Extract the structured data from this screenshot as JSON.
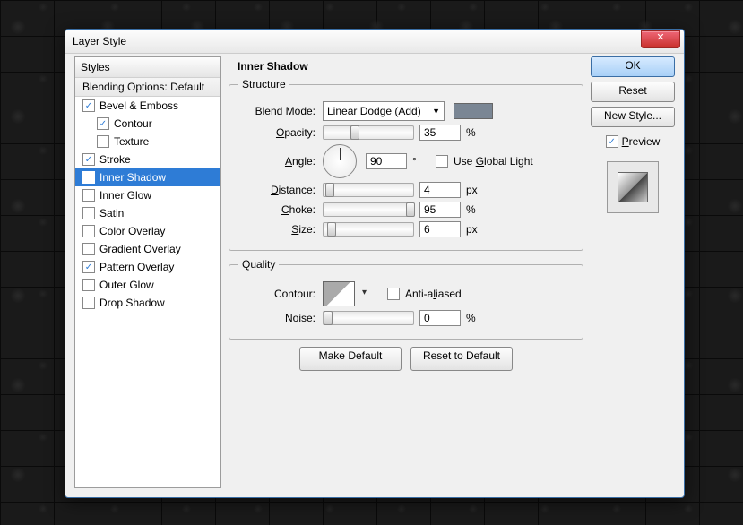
{
  "window_title": "Layer Style",
  "styles_header": "Styles",
  "blending": "Blending Options: Default",
  "styles": [
    {
      "label": "Bevel & Emboss",
      "checked": true,
      "indent": false
    },
    {
      "label": "Contour",
      "checked": true,
      "indent": true
    },
    {
      "label": "Texture",
      "checked": false,
      "indent": true
    },
    {
      "label": "Stroke",
      "checked": true,
      "indent": false
    },
    {
      "label": "Inner Shadow",
      "checked": true,
      "indent": false,
      "selected": true
    },
    {
      "label": "Inner Glow",
      "checked": false,
      "indent": false
    },
    {
      "label": "Satin",
      "checked": false,
      "indent": false
    },
    {
      "label": "Color Overlay",
      "checked": false,
      "indent": false
    },
    {
      "label": "Gradient Overlay",
      "checked": false,
      "indent": false
    },
    {
      "label": "Pattern Overlay",
      "checked": true,
      "indent": false
    },
    {
      "label": "Outer Glow",
      "checked": false,
      "indent": false
    },
    {
      "label": "Drop Shadow",
      "checked": false,
      "indent": false
    }
  ],
  "main_title": "Inner Shadow",
  "structure": {
    "legend": "Structure",
    "blend_mode_label": "Blend Mode:",
    "blend_mode_value": "Linear Dodge (Add)",
    "opacity_label": "Opacity:",
    "opacity_value": "35",
    "opacity_unit": "%",
    "opacity_thumb": 30,
    "angle_label": "Angle:",
    "angle_value": "90",
    "angle_unit": "°",
    "global_light": "Use Global Light",
    "global_light_checked": false,
    "distance_label": "Distance:",
    "distance_value": "4",
    "distance_unit": "px",
    "distance_thumb": 2,
    "choke_label": "Choke:",
    "choke_value": "95",
    "choke_unit": "%",
    "choke_thumb": 92,
    "size_label": "Size:",
    "size_value": "6",
    "size_unit": "px",
    "size_thumb": 4
  },
  "quality": {
    "legend": "Quality",
    "contour_label": "Contour:",
    "aa_label": "Anti-aliased",
    "aa_checked": false,
    "noise_label": "Noise:",
    "noise_value": "0",
    "noise_unit": "%",
    "noise_thumb": 0
  },
  "make_default": "Make Default",
  "reset_default": "Reset to Default",
  "right": {
    "ok": "OK",
    "reset": "Reset",
    "new_style": "New Style...",
    "preview": "Preview",
    "preview_checked": true
  }
}
